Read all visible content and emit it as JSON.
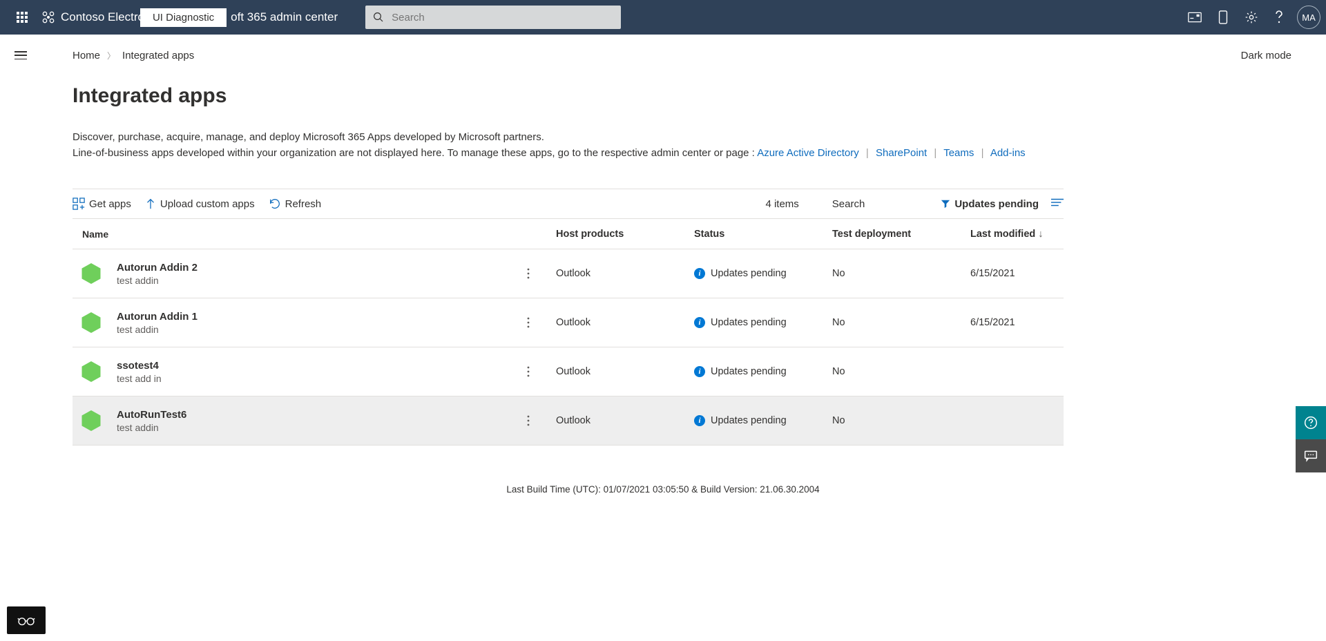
{
  "header": {
    "tenant": "Contoso Electro",
    "diag_chip": "UI Diagnostic",
    "title_suffix": "oft 365 admin center",
    "search_placeholder": "Search",
    "avatar_initials": "MA"
  },
  "breadcrumb": {
    "home": "Home",
    "current": "Integrated apps"
  },
  "darkmode_label": "Dark mode",
  "page_title": "Integrated apps",
  "description": {
    "line1": "Discover, purchase, acquire, manage, and deploy Microsoft 365 Apps developed by Microsoft partners.",
    "line2_prefix": "Line-of-business apps developed within your organization are not displayed here. To manage these apps, go to the respective admin center or page :",
    "links": {
      "aad": "Azure Active Directory",
      "sharepoint": "SharePoint",
      "teams": "Teams",
      "addins": "Add-ins"
    }
  },
  "commands": {
    "get_apps": "Get apps",
    "upload": "Upload custom apps",
    "refresh": "Refresh"
  },
  "items_count": "4 items",
  "search_label": "Search",
  "filter_label": "Updates pending",
  "columns": {
    "name": "Name",
    "host": "Host products",
    "status": "Status",
    "test": "Test deployment",
    "modified": "Last modified"
  },
  "rows": [
    {
      "name": "Autorun Addin 2",
      "sub": "test addin",
      "host": "Outlook",
      "status": "Updates pending",
      "test": "No",
      "modified": "6/15/2021",
      "selected": false
    },
    {
      "name": "Autorun Addin 1",
      "sub": "test addin",
      "host": "Outlook",
      "status": "Updates pending",
      "test": "No",
      "modified": "6/15/2021",
      "selected": false
    },
    {
      "name": "ssotest4",
      "sub": "test add in",
      "host": "Outlook",
      "status": "Updates pending",
      "test": "No",
      "modified": "",
      "selected": false
    },
    {
      "name": "AutoRunTest6",
      "sub": "test addin",
      "host": "Outlook",
      "status": "Updates pending",
      "test": "No",
      "modified": "",
      "selected": true
    }
  ],
  "footer": "Last Build Time (UTC): 01/07/2021 03:05:50 & Build Version: 21.06.30.2004"
}
